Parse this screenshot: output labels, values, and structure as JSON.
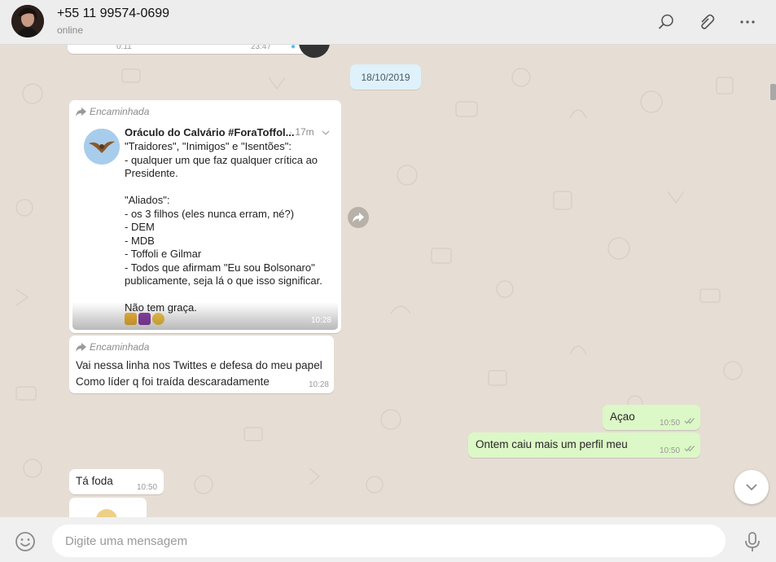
{
  "header": {
    "contact_name": "+55 11 99574-0699",
    "contact_status": "online",
    "icons": [
      "search-icon",
      "paperclip-icon",
      "menu-icon"
    ]
  },
  "chat": {
    "previous_message": {
      "time_left": "0:11",
      "time": "23:47"
    },
    "date_chip": "18/10/2019",
    "messages": [
      {
        "forwarded_label": "Encaminhada",
        "post": {
          "author": "Oráculo do Calvário #ForaToffol...",
          "age": "· 17m",
          "text": "\"Traidores\", \"Inimigos\" e \"Isentões\":\n- qualquer um que faz qualquer crítica ao Presidente.\n\n\"Aliados\":\n- os 3 filhos (eles nunca erram, né?)\n- DEM\n- MDB\n- Toffoli e Gilmar\n- Todos que afirmam \"Eu sou Bolsonaro\" publicamente, seja lá o que isso significar.\n\nNão tem graça.",
          "emoji_icons": [
            "facepunch-emoji",
            "libra-emoji",
            "grinning-emoji"
          ]
        },
        "time": "10:28"
      },
      {
        "forwarded_label": "Encaminhada",
        "text": "Vai nessa linha nos Twittes e defesa do meu papel\nComo líder q foi traída descaradamente",
        "time": "10:28"
      },
      {
        "text": "Açao",
        "time": "10:50",
        "outgoing": true
      },
      {
        "text": "Ontem caiu mais um perfil meu",
        "time": "10:50",
        "outgoing": true
      },
      {
        "text": "Tá foda",
        "time": "10:50"
      }
    ]
  },
  "footer": {
    "input_placeholder": "Digite uma mensagem",
    "input_value": ""
  },
  "colors": {
    "header_bg": "#ededed",
    "chat_bg": "#e6ded5",
    "incoming_bubble": "#ffffff",
    "outgoing_bubble": "#dcf8c6",
    "date_chip_bg": "#dff1fb"
  }
}
